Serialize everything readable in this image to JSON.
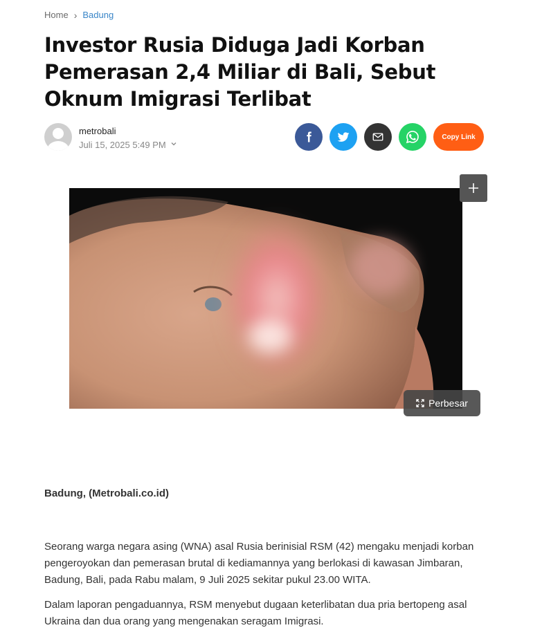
{
  "breadcrumb": {
    "home": "Home",
    "separator": "›",
    "category": "Badung"
  },
  "article": {
    "title": "Investor Rusia Diduga Jadi Korban Pemerasan 2,4 Miliar di Bali, Sebut Oknum Imigrasi Terlibat",
    "author": "metrobali",
    "date": "Juli 15, 2025 5:49 PM",
    "dateline": "Badung, (Metrobali.co.id)",
    "paragraphs": [
      "Seorang warga negara asing (WNA) asal Rusia berinisial RSM (42) mengaku menjadi korban pengeroyokan dan pemerasan brutal di kediamannya yang berlokasi di kawasan Jimbaran, Badung, Bali, pada Rabu malam, 9 Juli 2025 sekitar pukul 23.00 WITA.",
      "Dalam laporan pengaduannya, RSM menyebut dugaan keterlibatan dua pria bertopeng asal Ukraina dan dua orang yang mengenakan seragam Imigrasi."
    ]
  },
  "share": {
    "facebook_icon": "facebook-icon",
    "twitter_icon": "twitter-icon",
    "email_icon": "mail-icon",
    "whatsapp_icon": "whatsapp-icon",
    "copy_label": "Copy Link"
  },
  "image": {
    "enlarge_label": "Perbesar",
    "plus_icon": "plus-icon",
    "expand_icon": "expand-icon"
  },
  "colors": {
    "link": "#3a86c8",
    "facebook": "#3b5998",
    "twitter": "#1da1f2",
    "email": "#333333",
    "whatsapp": "#25d366",
    "copy_link": "#ff5e14"
  }
}
